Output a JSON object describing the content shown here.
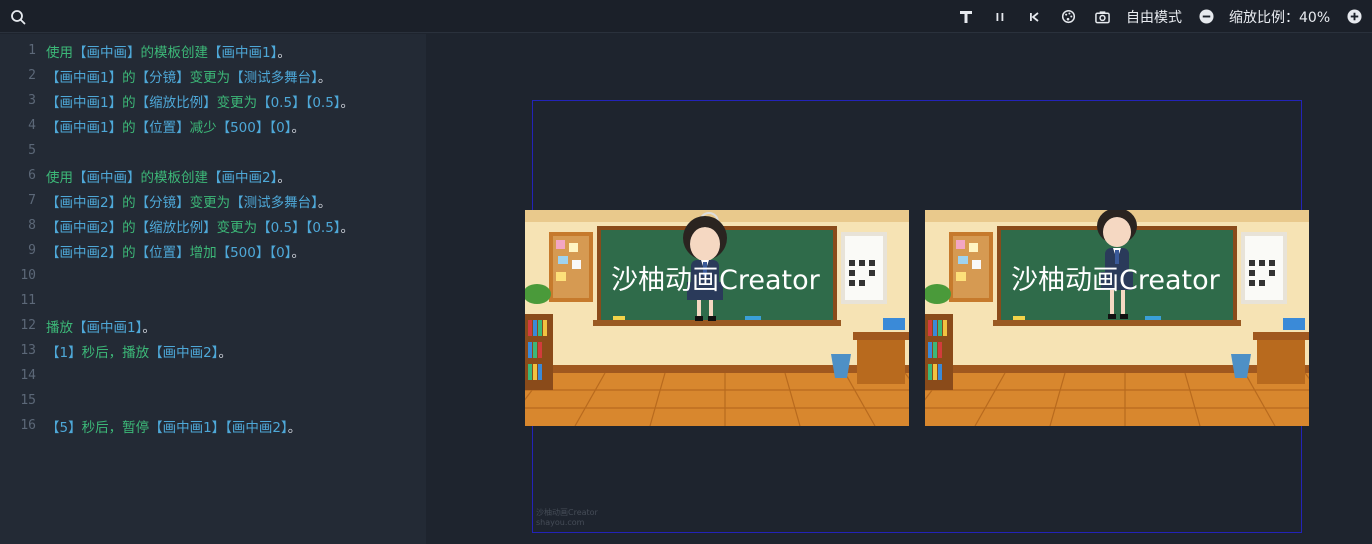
{
  "toolbar": {
    "mode_label": "自由模式",
    "zoom_label": "缩放比例：40%",
    "icons": [
      "search-icon",
      "text-tool-icon",
      "pause-icon",
      "step-back-icon",
      "palette-icon",
      "camera-icon",
      "zoom-out-icon",
      "zoom-in-icon"
    ]
  },
  "editor": {
    "lines": [
      {
        "n": "1",
        "tokens": [
          {
            "c": "cmd",
            "t": "使用"
          },
          {
            "c": "ref",
            "t": "【画中画】"
          },
          {
            "c": "cmd",
            "t": "的模板创建"
          },
          {
            "c": "ref",
            "t": "【画中画1】"
          },
          {
            "c": "punct",
            "t": "。"
          }
        ]
      },
      {
        "n": "2",
        "tokens": [
          {
            "c": "ref",
            "t": "【画中画1】"
          },
          {
            "c": "cmd",
            "t": "的"
          },
          {
            "c": "ref",
            "t": "【分镜】"
          },
          {
            "c": "cmd",
            "t": "变更为"
          },
          {
            "c": "ref",
            "t": "【测试多舞台】"
          },
          {
            "c": "punct",
            "t": "。"
          }
        ]
      },
      {
        "n": "3",
        "tokens": [
          {
            "c": "ref",
            "t": "【画中画1】"
          },
          {
            "c": "cmd",
            "t": "的"
          },
          {
            "c": "ref",
            "t": "【缩放比例】"
          },
          {
            "c": "cmd",
            "t": "变更为"
          },
          {
            "c": "num",
            "t": "【0.5】【0.5】"
          },
          {
            "c": "punct",
            "t": "。"
          }
        ]
      },
      {
        "n": "4",
        "tokens": [
          {
            "c": "ref",
            "t": "【画中画1】"
          },
          {
            "c": "cmd",
            "t": "的"
          },
          {
            "c": "ref",
            "t": "【位置】"
          },
          {
            "c": "cmd",
            "t": "减少"
          },
          {
            "c": "num",
            "t": "【500】【0】"
          },
          {
            "c": "punct",
            "t": "。"
          }
        ]
      },
      {
        "n": "5",
        "tokens": []
      },
      {
        "n": "6",
        "tokens": [
          {
            "c": "cmd",
            "t": "使用"
          },
          {
            "c": "ref",
            "t": "【画中画】"
          },
          {
            "c": "cmd",
            "t": "的模板创建"
          },
          {
            "c": "ref",
            "t": "【画中画2】"
          },
          {
            "c": "punct",
            "t": "。"
          }
        ]
      },
      {
        "n": "7",
        "tokens": [
          {
            "c": "ref",
            "t": "【画中画2】"
          },
          {
            "c": "cmd",
            "t": "的"
          },
          {
            "c": "ref",
            "t": "【分镜】"
          },
          {
            "c": "cmd",
            "t": "变更为"
          },
          {
            "c": "ref",
            "t": "【测试多舞台】"
          },
          {
            "c": "punct",
            "t": "。"
          }
        ]
      },
      {
        "n": "8",
        "tokens": [
          {
            "c": "ref",
            "t": "【画中画2】"
          },
          {
            "c": "cmd",
            "t": "的"
          },
          {
            "c": "ref",
            "t": "【缩放比例】"
          },
          {
            "c": "cmd",
            "t": "变更为"
          },
          {
            "c": "num",
            "t": "【0.5】【0.5】"
          },
          {
            "c": "punct",
            "t": "。"
          }
        ]
      },
      {
        "n": "9",
        "tokens": [
          {
            "c": "ref",
            "t": "【画中画2】"
          },
          {
            "c": "cmd",
            "t": "的"
          },
          {
            "c": "ref",
            "t": "【位置】"
          },
          {
            "c": "cmd",
            "t": "增加"
          },
          {
            "c": "num",
            "t": "【500】【0】"
          },
          {
            "c": "punct",
            "t": "。"
          }
        ]
      },
      {
        "n": "10",
        "tokens": []
      },
      {
        "n": "11",
        "tokens": []
      },
      {
        "n": "12",
        "tokens": [
          {
            "c": "cmd",
            "t": "播放"
          },
          {
            "c": "ref",
            "t": "【画中画1】"
          },
          {
            "c": "punct",
            "t": "。"
          }
        ]
      },
      {
        "n": "13",
        "tokens": [
          {
            "c": "num",
            "t": "【1】"
          },
          {
            "c": "cmd",
            "t": "秒后，播放"
          },
          {
            "c": "ref",
            "t": "【画中画2】"
          },
          {
            "c": "punct",
            "t": "。"
          }
        ]
      },
      {
        "n": "14",
        "tokens": []
      },
      {
        "n": "15",
        "tokens": []
      },
      {
        "n": "16",
        "tokens": [
          {
            "c": "num",
            "t": "【5】"
          },
          {
            "c": "cmd",
            "t": "秒后，暂停"
          },
          {
            "c": "ref",
            "t": "【画中画1】【画中画2】"
          },
          {
            "c": "punct",
            "t": "。"
          }
        ]
      }
    ]
  },
  "stage": {
    "scenes": [
      {
        "id": "1",
        "title": "沙柚动画Creator"
      },
      {
        "id": "2",
        "title": "沙柚动画Creator"
      }
    ],
    "watermark_line1": "沙柚动画Creator",
    "watermark_line2": "shayou.com"
  },
  "colors": {
    "cmd": "#3cb878",
    "ref": "#4ea8d8",
    "frame": "#2323b8",
    "chalkboard": "#2f6b4a"
  }
}
